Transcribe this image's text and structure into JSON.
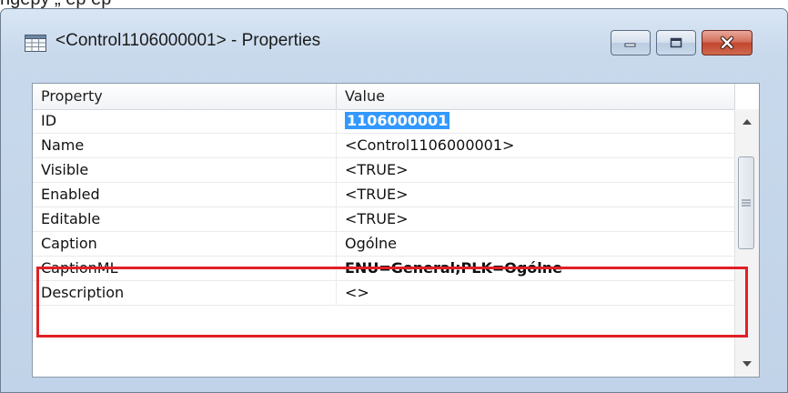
{
  "top_text": "ngepy          „          ep          ep",
  "window": {
    "title": "<Control1106000001> - Properties",
    "icon": "table-window-icon",
    "buttons": {
      "minimize": "minimize-icon",
      "maximize": "maximize-icon",
      "close": "close-icon"
    }
  },
  "grid": {
    "columns": [
      "Property",
      "Value"
    ],
    "rows": [
      {
        "property": "ID",
        "value": "1106000001",
        "selected": true
      },
      {
        "property": "Name",
        "value": "<Control1106000001>"
      },
      {
        "property": "Visible",
        "value": "<TRUE>"
      },
      {
        "property": "Enabled",
        "value": "<TRUE>"
      },
      {
        "property": "Editable",
        "value": "<TRUE>"
      },
      {
        "property": "Caption",
        "value": "Ogólne"
      },
      {
        "property": "CaptionML",
        "value": "ENU=General;PLK=Ogólne",
        "bold": true
      },
      {
        "property": "Description",
        "value": "<>"
      }
    ]
  },
  "highlight": {
    "color": "#e21f26",
    "rows": [
      "Caption",
      "CaptionML"
    ]
  },
  "colors": {
    "selection": "#3399ff",
    "close_button": "#c2462f"
  }
}
